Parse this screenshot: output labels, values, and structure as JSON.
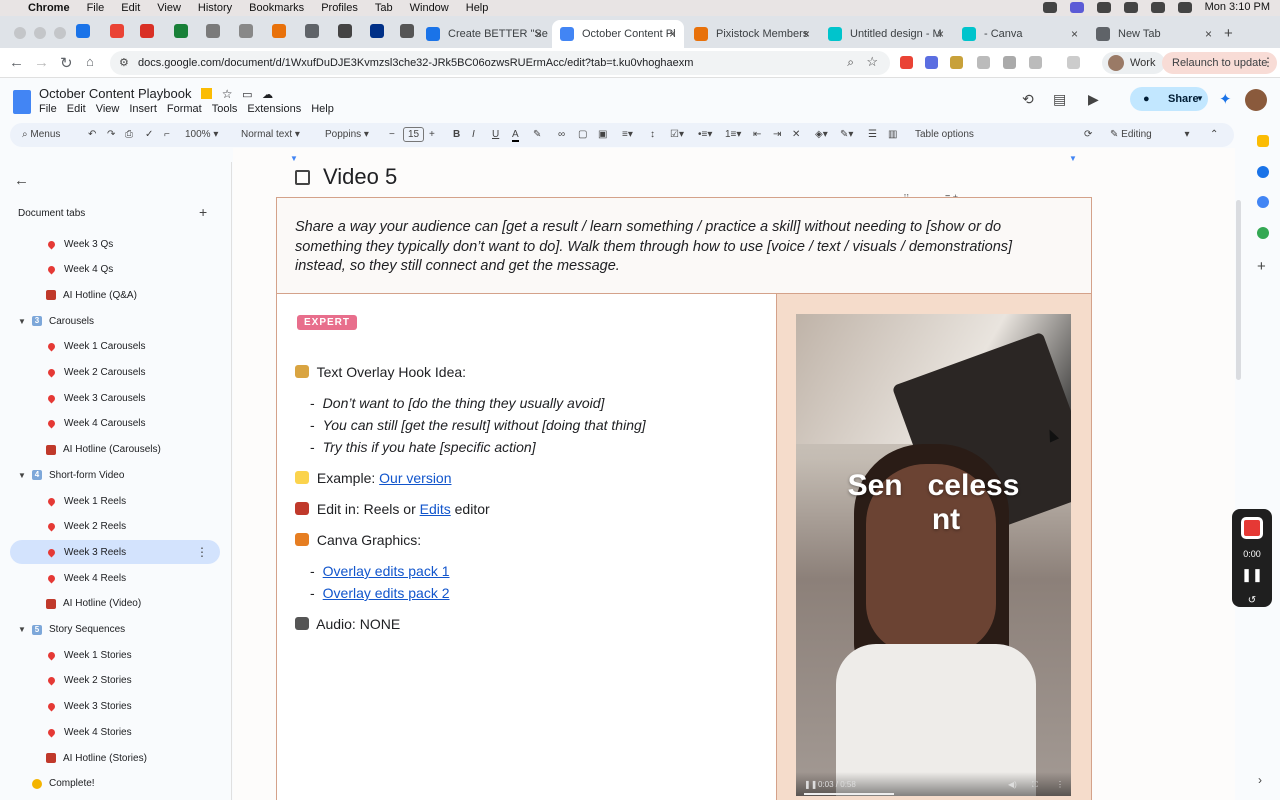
{
  "macbar": {
    "app": "Chrome",
    "menus": [
      "File",
      "Edit",
      "View",
      "History",
      "Bookmarks",
      "Profiles",
      "Tab",
      "Window",
      "Help"
    ],
    "clock": "Mon 3:10 PM"
  },
  "tabs": [
    {
      "title": "Create BETTER \"Se",
      "color": "#1a73e8"
    },
    {
      "title": "October Content Pl",
      "color": "#4285f4",
      "active": true
    },
    {
      "title": "Pixistock Members",
      "color": "#e8710a"
    },
    {
      "title": "Untitled design - M",
      "color": "#00c4cc"
    },
    {
      "title": "- Canva",
      "color": "#00c4cc"
    },
    {
      "title": "New Tab",
      "color": "#5f6368"
    }
  ],
  "browser": {
    "url": "docs.google.com/document/d/1WxufDuDJE3Kvmzsl3che32-JRk5BC06ozwsRUErmAcc/edit?tab=t.ku0vhoghaexm",
    "profile": "Work",
    "relaunch": "Relaunch to update"
  },
  "doc": {
    "title": "October Content Playbook",
    "menus": [
      "File",
      "Edit",
      "View",
      "Insert",
      "Format",
      "Tools",
      "Extensions",
      "Help"
    ],
    "share": "Share"
  },
  "format_toolbar": {
    "menus_search": "Menus",
    "zoom": "100%",
    "style": "Normal text",
    "font": "Poppins",
    "size": "15",
    "table_options": "Table options",
    "mode": "Editing"
  },
  "sidebar": {
    "header": "Document tabs",
    "items": [
      {
        "label": "Week 3 Qs",
        "type": "pin",
        "indent": 2
      },
      {
        "label": "Week 4 Qs",
        "type": "pin",
        "indent": 2
      },
      {
        "label": "AI Hotline (Q&A)",
        "type": "house",
        "indent": 2
      },
      {
        "label": "Carousels",
        "type": "num",
        "num": "3",
        "indent": 1
      },
      {
        "label": "Week 1 Carousels",
        "type": "pin",
        "indent": 2
      },
      {
        "label": "Week 2 Carousels",
        "type": "pin",
        "indent": 2
      },
      {
        "label": "Week 3 Carousels",
        "type": "pin",
        "indent": 2
      },
      {
        "label": "Week 4 Carousels",
        "type": "pin",
        "indent": 2
      },
      {
        "label": "AI Hotline (Carousels)",
        "type": "house",
        "indent": 2
      },
      {
        "label": "Short-form Video",
        "type": "num",
        "num": "4",
        "indent": 1
      },
      {
        "label": "Week 1 Reels",
        "type": "pin",
        "indent": 2
      },
      {
        "label": "Week 2 Reels",
        "type": "pin",
        "indent": 2
      },
      {
        "label": "Week 3 Reels",
        "type": "pin",
        "indent": 2,
        "selected": true
      },
      {
        "label": "Week 4 Reels",
        "type": "pin",
        "indent": 2
      },
      {
        "label": "AI Hotline (Video)",
        "type": "house",
        "indent": 2
      },
      {
        "label": "Story Sequences",
        "type": "num",
        "num": "5",
        "indent": 1
      },
      {
        "label": "Week 1 Stories",
        "type": "pin",
        "indent": 2
      },
      {
        "label": "Week 2 Stories",
        "type": "pin",
        "indent": 2
      },
      {
        "label": "Week 3 Stories",
        "type": "pin",
        "indent": 2
      },
      {
        "label": "Week 4 Stories",
        "type": "pin",
        "indent": 2
      },
      {
        "label": "AI Hotline (Stories)",
        "type": "house",
        "indent": 2
      },
      {
        "label": "Complete!",
        "type": "emoji",
        "indent": 0
      }
    ]
  },
  "content": {
    "heading": "Video 5",
    "prompt": "Share a way your audience can [get a result / learn something / practice a skill] without needing to [show or do something they typically don’t want to do]. Walk them through how to use [voice / text / visuals / demonstrations] instead, so they still connect and get the message.",
    "badge": "EXPERT",
    "hook_label": "Text Overlay Hook Idea:",
    "hooks": [
      "Don’t want to [do the thing they usually avoid]",
      "You can still [get the result] without [doing that thing]",
      "Try this if you hate [specific action]"
    ],
    "example_label": "Example:",
    "example_link": "Our version",
    "edit_label": "Edit in:",
    "edit_text_1": "Reels or",
    "edit_link": "Edits",
    "edit_text_2": "editor",
    "canva_label": "Canva Graphics:",
    "canva_links": [
      "Overlay edits pack 1",
      "Overlay edits pack 2"
    ],
    "audio_label": "Audio:",
    "audio_value": "NONE",
    "video_overlay": "Sen   celess\n   nt",
    "video_time": "0:03 / 0:58"
  },
  "recorder": {
    "time": "0:00"
  }
}
